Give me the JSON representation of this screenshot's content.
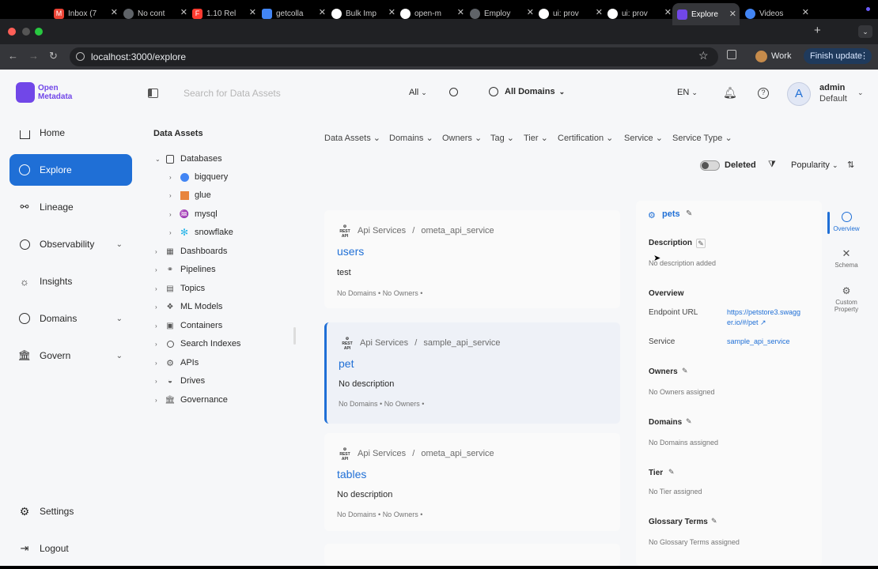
{
  "browser": {
    "tabs": [
      {
        "label": "Inbox (7",
        "icon_color": "#ea4335",
        "icon": "gmail-icon"
      },
      {
        "label": "No cont",
        "icon_color": "#888888",
        "icon": "globe-icon"
      },
      {
        "label": "1.10 Rel",
        "icon_color": "#ff3b30",
        "icon": "figma-icon"
      },
      {
        "label": "getcolla",
        "icon_color": "#4285f4",
        "icon": "docs-icon"
      },
      {
        "label": "Bulk Imp",
        "icon_color": "#ffffff",
        "icon": "github-icon"
      },
      {
        "label": "open-m",
        "icon_color": "#ffffff",
        "icon": "github-icon"
      },
      {
        "label": "Employ",
        "icon_color": "#888888",
        "icon": "globe-icon"
      },
      {
        "label": "ui: prov",
        "icon_color": "#ffffff",
        "icon": "github-icon"
      },
      {
        "label": "ui: prov",
        "icon_color": "#ffffff",
        "icon": "github-icon"
      },
      {
        "label": "Explore",
        "icon_color": "#7147e8",
        "icon": "openmetadata-icon"
      },
      {
        "label": "Videos",
        "icon_color": "#4285f4",
        "icon": "loom-icon"
      }
    ],
    "url": "localhost:3000/explore",
    "profile_label": "Work",
    "update_label": "Finish update"
  },
  "app": {
    "logo_line1": "Open",
    "logo_line2": "Metadata",
    "search_placeholder": "Search for Data Assets",
    "search_scope": "All",
    "domains_label": "All Domains",
    "language": "EN",
    "user_initial": "A",
    "user_name": "admin",
    "user_role": "Default"
  },
  "nav": {
    "home": "Home",
    "explore": "Explore",
    "lineage": "Lineage",
    "observability": "Observability",
    "insights": "Insights",
    "domains": "Domains",
    "govern": "Govern",
    "settings": "Settings",
    "logout": "Logout"
  },
  "tree": {
    "title": "Data Assets",
    "databases": "Databases",
    "db_children": [
      "bigquery",
      "glue",
      "mysql",
      "snowflake"
    ],
    "others": [
      "Dashboards",
      "Pipelines",
      "Topics",
      "ML Models",
      "Containers",
      "Search Indexes",
      "APIs",
      "Drives",
      "Governance"
    ]
  },
  "filters": {
    "items": [
      "Data Assets",
      "Domains",
      "Owners",
      "Tag",
      "Tier",
      "Certification",
      "Service",
      "Service Type"
    ],
    "deleted": "Deleted",
    "sort": "Popularity"
  },
  "results": [
    {
      "service": "Api Services",
      "sep": "/",
      "service_name": "ometa_api_service",
      "name": "users",
      "desc": "test",
      "domains": "No Domains",
      "owners": "No Owners"
    },
    {
      "service": "Api Services",
      "sep": "/",
      "service_name": "sample_api_service",
      "name": "pet",
      "desc": "No description",
      "domains": "No Domains",
      "owners": "No Owners"
    },
    {
      "service": "Api Services",
      "sep": "/",
      "service_name": "ometa_api_service",
      "name": "tables",
      "desc": "No description",
      "domains": "No Domains",
      "owners": "No Owners"
    }
  ],
  "detail": {
    "title": "pets",
    "description_label": "Description",
    "description_value": "No description added",
    "overview_label": "Overview",
    "endpoint_label": "Endpoint URL",
    "endpoint_line1": "https://petstore3.swagg",
    "endpoint_line2": "er.io/#/pet",
    "service_label": "Service",
    "service_value": "sample_api_service",
    "owners_label": "Owners",
    "owners_value": "No Owners assigned",
    "domains_label": "Domains",
    "domains_value": "No Domains assigned",
    "tier_label": "Tier",
    "tier_value": "No Tier assigned",
    "glossary_label": "Glossary Terms",
    "glossary_value": "No Glossary Terms assigned"
  },
  "rail": {
    "overview": "Overview",
    "schema": "Schema",
    "custom1": "Custom",
    "custom2": "Property"
  },
  "colors": {
    "accent": "#1f6fd6",
    "brand": "#7147e8"
  }
}
